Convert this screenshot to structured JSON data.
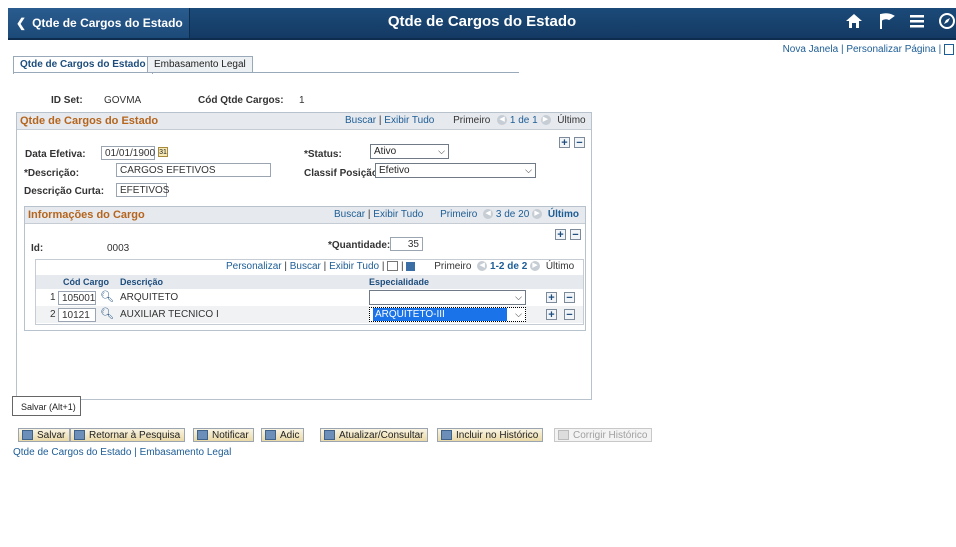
{
  "banner": {
    "back_label": "Qtde de Cargos do Estado",
    "title": "Qtde de Cargos do Estado",
    "icons": [
      "home-icon",
      "flag-icon",
      "menu-icon",
      "navbar-compass-icon"
    ]
  },
  "top_links": {
    "new_window": "Nova Janela",
    "sep": "|",
    "personalize": "Personalizar Página",
    "sep2": "|"
  },
  "tabs": [
    {
      "label": "Qtde de Cargos do Estado",
      "active": true
    },
    {
      "label": "Embasamento Legal",
      "active": false
    }
  ],
  "header": {
    "setid_label": "ID Set:",
    "setid_value": "GOVMA",
    "qty_code_label": "Cód Qtde Cargos:",
    "qty_code_value": "1"
  },
  "level1": {
    "title": "Qtde de Cargos do Estado",
    "nav": {
      "find": "Buscar",
      "sep": "|",
      "view_all": "Exibir Tudo",
      "first": "Primeiro",
      "range": "1 de 1",
      "last": "Último"
    },
    "effdt_label": "Data Efetiva:",
    "effdt_value": "01/01/1900",
    "status_label": "*Status:",
    "status_value": "Ativo",
    "descr_label": "*Descrição:",
    "descr_value": "CARGOS EFETIVOS",
    "classif_label": "Classif Posição:",
    "classif_value": "Efetivo",
    "short_label": "Descrição Curta:",
    "short_value": "EFETIVOS"
  },
  "level2": {
    "title": "Informações do Cargo",
    "nav": {
      "find": "Buscar",
      "sep": "|",
      "view_all": "Exibir Tudo",
      "first": "Primeiro",
      "range": "3 de 20",
      "last": "Último"
    },
    "id_label": "Id:",
    "id_value": "0003",
    "qty_label": "*Quantidade:",
    "qty_value": "35"
  },
  "grid": {
    "nav": {
      "personalize": "Personalizar",
      "sep": "|",
      "find": "Buscar",
      "sep2": "|",
      "view_all": "Exibir Tudo",
      "sep3": "|",
      "sep4": "|",
      "first": "Primeiro",
      "range": "1-2 de 2",
      "last": "Último"
    },
    "columns": [
      "Cód Cargo",
      "Descrição",
      "Especialidade"
    ],
    "rows": [
      {
        "num": "1",
        "code": "105001",
        "descr": "ARQUITETO",
        "specialty": ""
      },
      {
        "num": "2",
        "code": "10121",
        "descr": "AUXILIAR TECNICO I",
        "specialty": "ARQUITETO-III"
      }
    ]
  },
  "tooltip": "Salvar (Alt+1)",
  "toolbar": [
    {
      "label": "Salvar",
      "disabled": false
    },
    {
      "label": "Retornar à Pesquisa",
      "disabled": false
    },
    {
      "label": "Notificar",
      "disabled": false
    },
    {
      "label": "Adic",
      "disabled": false
    },
    {
      "label": "Atualizar/Consultar",
      "disabled": false
    },
    {
      "label": "Incluir no Histórico",
      "disabled": false
    },
    {
      "label": "Corrigir Histórico",
      "disabled": true
    }
  ],
  "footer_links": {
    "page1": "Qtde de Cargos do Estado",
    "sep": "|",
    "page2": "Embasamento Legal"
  },
  "colors": {
    "banner": "#1b4a79",
    "group_title": "#b5651d",
    "link": "#1d5d96",
    "selected_highlight": "#1a73e8"
  }
}
